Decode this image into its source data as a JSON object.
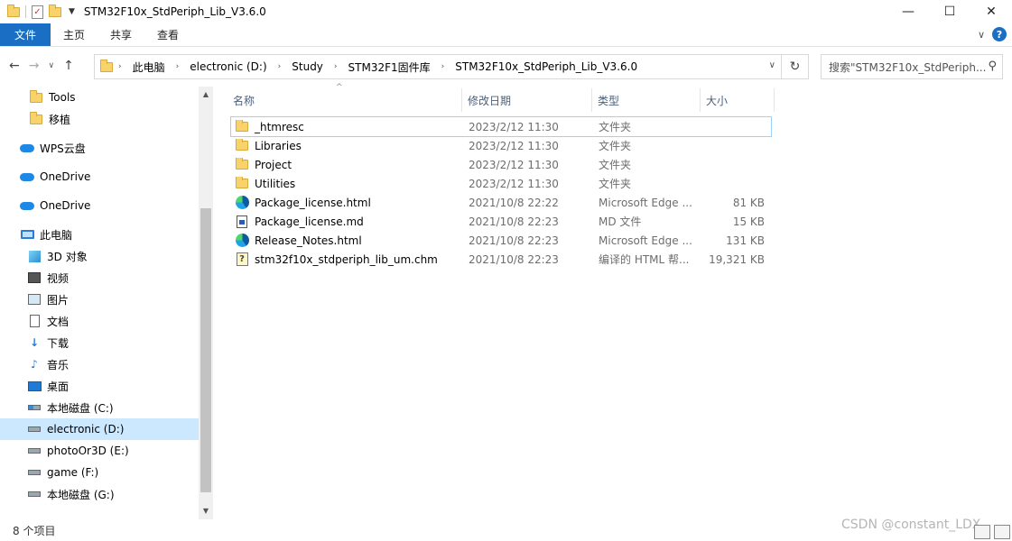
{
  "window": {
    "title": "STM32F10x_StdPeriph_Lib_V3.6.0",
    "controls": {
      "minimize": "—",
      "maximize": "☐",
      "close": "✕"
    }
  },
  "ribbon": {
    "tabs": [
      "文件",
      "主页",
      "共享",
      "查看"
    ],
    "help": "?"
  },
  "address": {
    "crumbs": [
      "此电脑",
      "electronic (D:)",
      "Study",
      "STM32F1固件库",
      "STM32F10x_StdPeriph_Lib_V3.6.0"
    ]
  },
  "search": {
    "placeholder": "搜索\"STM32F10x_StdPeriph..."
  },
  "sidebar": {
    "items": [
      {
        "label": "Tools",
        "icon": "folder-icon"
      },
      {
        "label": "移植",
        "icon": "folder-icon"
      },
      {
        "label": "WPS云盘",
        "icon": "cloud-icon"
      },
      {
        "label": "OneDrive",
        "icon": "onedrive-icon"
      },
      {
        "label": "OneDrive",
        "icon": "onedrive-icon"
      },
      {
        "label": "此电脑",
        "icon": "pc-icon"
      },
      {
        "label": "3D 对象",
        "icon": "cube-icon"
      },
      {
        "label": "视频",
        "icon": "video-icon"
      },
      {
        "label": "图片",
        "icon": "picture-icon"
      },
      {
        "label": "文档",
        "icon": "document-icon"
      },
      {
        "label": "下载",
        "icon": "download-icon"
      },
      {
        "label": "音乐",
        "icon": "music-icon"
      },
      {
        "label": "桌面",
        "icon": "desktop-icon"
      },
      {
        "label": "本地磁盘 (C:)",
        "icon": "system-drive-icon"
      },
      {
        "label": "electronic (D:)",
        "icon": "drive-icon",
        "selected": true
      },
      {
        "label": "photoOr3D (E:)",
        "icon": "drive-icon"
      },
      {
        "label": "game (F:)",
        "icon": "drive-icon"
      },
      {
        "label": "本地磁盘 (G:)",
        "icon": "drive-icon"
      }
    ]
  },
  "columns": {
    "name": "名称",
    "date": "修改日期",
    "type": "类型",
    "size": "大小"
  },
  "files": [
    {
      "name": "_htmresc",
      "date": "2023/2/12 11:30",
      "type": "文件夹",
      "size": "",
      "icon": "folder-icon"
    },
    {
      "name": "Libraries",
      "date": "2023/2/12 11:30",
      "type": "文件夹",
      "size": "",
      "icon": "folder-icon"
    },
    {
      "name": "Project",
      "date": "2023/2/12 11:30",
      "type": "文件夹",
      "size": "",
      "icon": "folder-icon"
    },
    {
      "name": "Utilities",
      "date": "2023/2/12 11:30",
      "type": "文件夹",
      "size": "",
      "icon": "folder-icon"
    },
    {
      "name": "Package_license.html",
      "date": "2021/10/8 22:22",
      "type": "Microsoft Edge ...",
      "size": "81 KB",
      "icon": "edge-icon"
    },
    {
      "name": "Package_license.md",
      "date": "2021/10/8 22:23",
      "type": "MD 文件",
      "size": "15 KB",
      "icon": "md-file-icon"
    },
    {
      "name": "Release_Notes.html",
      "date": "2021/10/8 22:23",
      "type": "Microsoft Edge ...",
      "size": "131 KB",
      "icon": "edge-icon"
    },
    {
      "name": "stm32f10x_stdperiph_lib_um.chm",
      "date": "2021/10/8 22:23",
      "type": "编译的 HTML 帮...",
      "size": "19,321 KB",
      "icon": "chm-icon"
    }
  ],
  "status": {
    "count": "8 个项目"
  },
  "watermark": "CSDN @constant_LDX"
}
